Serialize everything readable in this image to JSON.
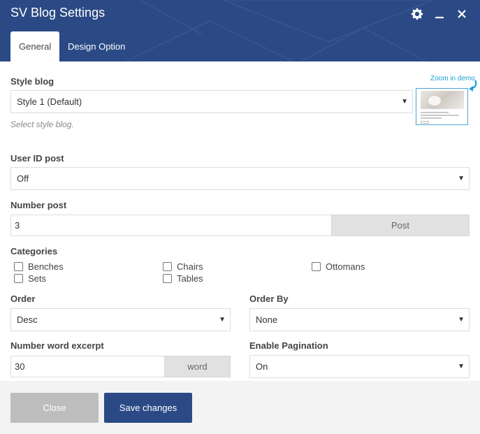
{
  "header": {
    "title": "SV Blog Settings",
    "icons": [
      "gear-icon",
      "minimize-icon",
      "close-icon"
    ],
    "bg_color": "#2b4a85"
  },
  "tabs": [
    {
      "label": "General",
      "active": true
    },
    {
      "label": "Design Option",
      "active": false
    }
  ],
  "style_blog": {
    "label": "Style blog",
    "value": "Style 1 (Default)",
    "hint": "Select style blog.",
    "zoom_link": "Zoom in demo"
  },
  "user_id_post": {
    "label": "User ID post",
    "value": "Off"
  },
  "number_post": {
    "label": "Number post",
    "value": "3",
    "addon": "Post"
  },
  "categories": {
    "label": "Categories",
    "items": [
      {
        "label": "Benches",
        "checked": false
      },
      {
        "label": "Chairs",
        "checked": false
      },
      {
        "label": "Ottomans",
        "checked": false
      },
      {
        "label": "Sets",
        "checked": false
      },
      {
        "label": "Tables",
        "checked": false
      }
    ]
  },
  "order": {
    "label": "Order",
    "value": "Desc"
  },
  "order_by": {
    "label": "Order By",
    "value": "None"
  },
  "word_excerpt": {
    "label": "Number word excerpt",
    "value": "30",
    "addon": "word"
  },
  "pagination": {
    "label": "Enable Pagination",
    "value": "On"
  },
  "footer": {
    "close_label": "Close",
    "save_label": "Save changes"
  }
}
